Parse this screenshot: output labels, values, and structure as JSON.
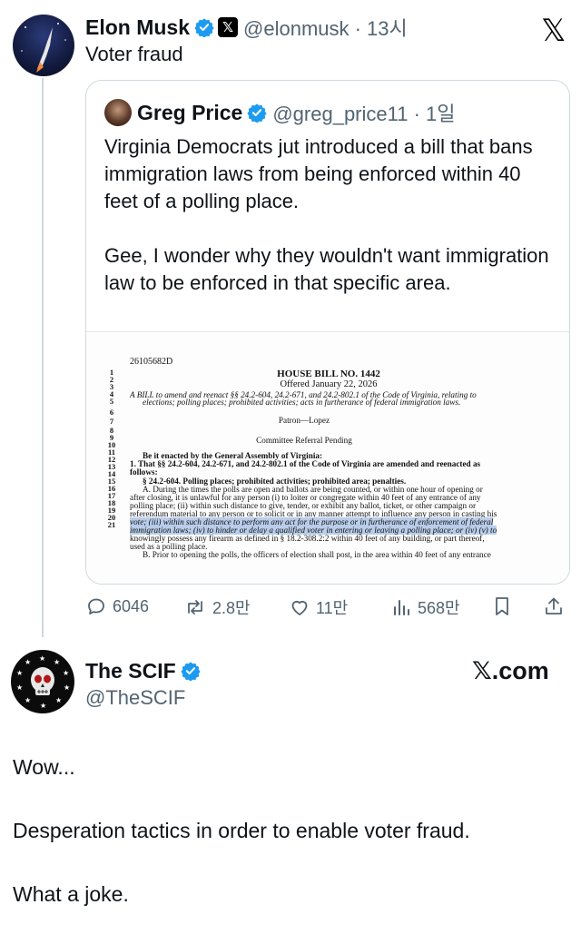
{
  "main_tweet": {
    "name": "Elon Musk",
    "handle_time": "@elonmusk · 13시",
    "x_badge": "𝕏",
    "text": "Voter fraud",
    "top_right_logo": "𝕏"
  },
  "quote": {
    "name": "Greg Price",
    "handle_time": "@greg_price11 · 1일",
    "text": "Virginia Democrats jut introduced a bill that bans immigration laws from being enforced within 40 feet of a polling place.\n\nGee, I wonder why they wouldn't want immigration law to be enforced in that specific area.",
    "document": {
      "ref": "26105682D",
      "bill": "HOUSE BILL NO. 1442",
      "offered": "Offered January 22, 2026",
      "line_numbers": [
        "1",
        "2",
        "3",
        "4",
        "5",
        "6",
        "7",
        "8",
        "9",
        "10",
        "11",
        "12",
        "13",
        "14",
        "15",
        "16",
        "17",
        "18",
        "19",
        "20",
        "21"
      ],
      "lines": [
        "A BILL to amend and reenact §§ 24.2-604, 24.2-671, and 24.2-802.1 of the Code of Virginia, relating to",
        "elections; polling places; prohibited activities; acts in furtherance of federal immigration laws.",
        "Patron—Lopez",
        "Committee Referral Pending",
        "Be it enacted by the General Assembly of Virginia:",
        "1. That §§ 24.2-604, 24.2-671, and 24.2-802.1 of the Code of Virginia are amended and reenacted as",
        "follows:",
        "§ 24.2-604. Polling places; prohibited activities; prohibited area; penalties.",
        "A. During the times the polls are open and ballots are being counted, or within one hour of opening or",
        "after closing, it is unlawful for any person (i) to loiter or congregate within 40 feet of any entrance of any",
        "polling place; (ii) within such distance to give, tender, or exhibit any ballot, ticket, or other campaign or",
        "referendum material to any person or to solicit or in any manner attempt to influence any person in casting his",
        "vote; (iii) within such distance to perform any act for the purpose or in furtherance of enforcement of federal",
        "immigration laws; (iv) to hinder or delay a qualified voter in entering or leaving a polling place; or (iv) (v) to",
        "knowingly possess any firearm as defined in § 18.2-308.2:2 within 40 feet of any building, or part thereof,",
        "used as a polling place.",
        "B. Prior to opening the polls, the officers of election shall post, in the area within 40 feet of any entrance"
      ]
    }
  },
  "actions": {
    "replies": "6046",
    "reposts": "2.8만",
    "likes": "11만",
    "views": "568만"
  },
  "second_tweet": {
    "name": "The SCIF",
    "handle": "@TheSCIF",
    "x_com": "𝕏.com",
    "lines": [
      "Wow...",
      "Desperation tactics in order to enable voter fraud.",
      "What a joke."
    ]
  },
  "colors": {
    "verified_blue": "#1d9bf0",
    "secondary_text": "#536471",
    "highlight": "#b9cdea"
  }
}
